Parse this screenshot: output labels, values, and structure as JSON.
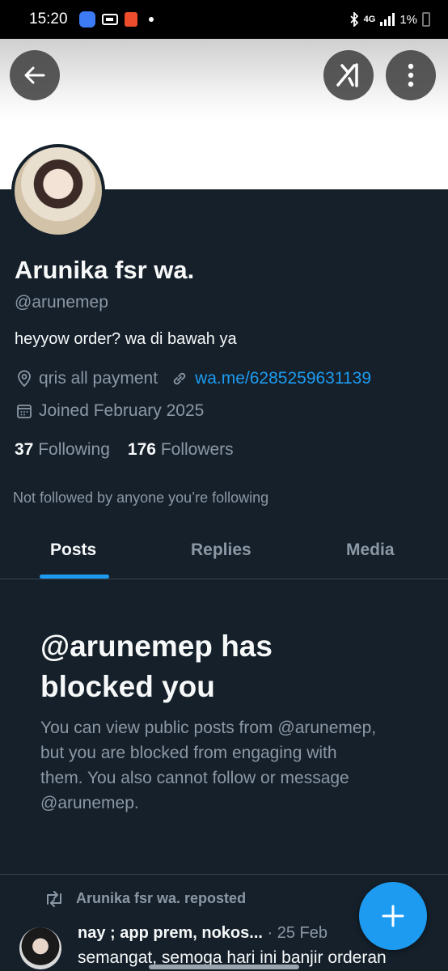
{
  "status_bar": {
    "time": "15:20",
    "network": "4G",
    "battery": "1%",
    "icons": [
      "app-icon",
      "card-icon",
      "shop-icon",
      "dot-icon",
      "bluetooth-icon",
      "signal-icon",
      "battery-icon"
    ]
  },
  "header": {
    "back_icon": "back-arrow-icon",
    "grok_icon": "grok-icon",
    "more_icon": "more-vertical-icon"
  },
  "profile": {
    "name": "Arunika fsr wa.",
    "handle": "@arunemep",
    "bio": "heyyow order? wa di bawah ya",
    "location": "qris all payment",
    "website": "wa.me/6285259631139",
    "joined": "Joined February 2025",
    "following_count": "37",
    "following_label": "Following",
    "followers_count": "176",
    "followers_label": "Followers",
    "not_followed_text": "Not followed by anyone you’re following"
  },
  "tabs": [
    {
      "label": "Posts",
      "active": true
    },
    {
      "label": "Replies",
      "active": false
    },
    {
      "label": "Media",
      "active": false
    }
  ],
  "blocked": {
    "title": "@arunemep has blocked you",
    "description": "You can view public posts from @arunemep, but you are blocked from engaging with them. You also cannot follow or message @arunemep."
  },
  "tweet": {
    "repost_label": "Arunika fsr wa. reposted",
    "author": "nay ; app prem, nokos...",
    "meta": " · 25 Feb",
    "text": "semangat, semoga hari ini banjir orderan"
  },
  "colors": {
    "background": "#15202b",
    "accent": "#1d9bf0",
    "secondary_text": "#8b98a5"
  }
}
